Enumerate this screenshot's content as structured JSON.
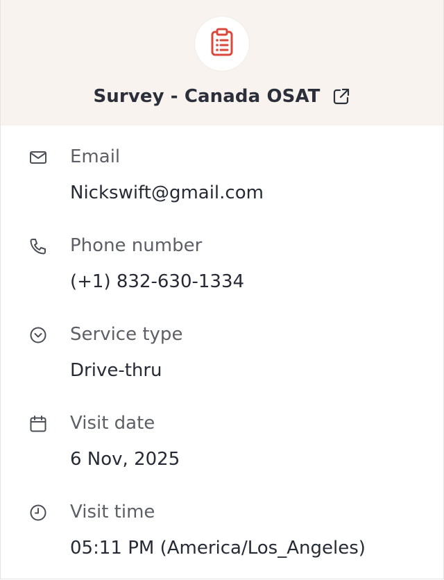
{
  "header": {
    "title": "Survey - Canada OSAT",
    "badge_icon": "clipboard-list-icon",
    "link_icon": "external-link-icon",
    "accent_color": "#d9483b"
  },
  "details": [
    {
      "icon": "mail-icon",
      "label": "Email",
      "value": "Nickswift@gmail.com"
    },
    {
      "icon": "phone-icon",
      "label": "Phone number",
      "value": "(+1) 832-630-1334"
    },
    {
      "icon": "chevron-circle-icon",
      "label": "Service type",
      "value": "Drive-thru"
    },
    {
      "icon": "calendar-icon",
      "label": "Visit date",
      "value": "6 Nov, 2025"
    },
    {
      "icon": "clock-icon",
      "label": "Visit time",
      "value": "05:11 PM (America/Los_Angeles)"
    }
  ]
}
